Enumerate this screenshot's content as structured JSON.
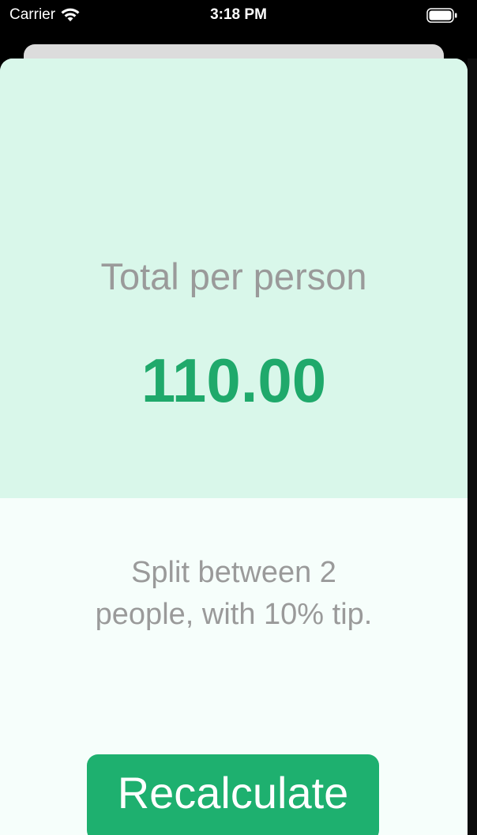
{
  "status_bar": {
    "carrier": "Carrier",
    "time": "3:18 PM",
    "wifi_icon": "wifi-icon",
    "battery_icon": "battery-icon"
  },
  "result": {
    "title": "Total per person",
    "total": "110.00",
    "settings_line1": "Split between 2",
    "settings_line2": "people, with 10% tip."
  },
  "actions": {
    "recalculate_label": "Recalculate"
  },
  "colors": {
    "accent": "#1eb06f",
    "top_panel": "#d9f7ea",
    "bottom_panel": "#f6fefb",
    "label_text": "#9a9a9a"
  }
}
